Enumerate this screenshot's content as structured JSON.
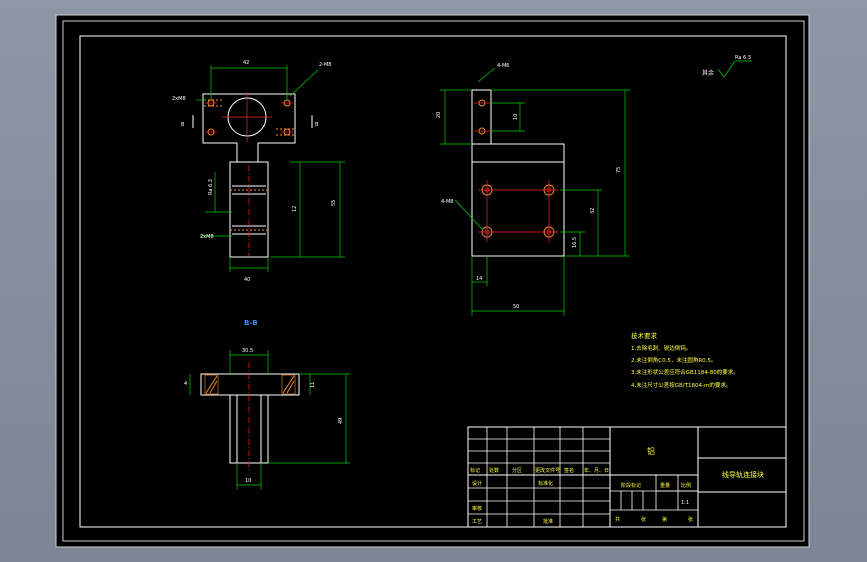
{
  "drawing": {
    "roughness_symbol_text": "Ra 6.3",
    "roughness_prefix": "其余",
    "section_label": "B-B",
    "label_4M6": "4-M6",
    "label_2M8": "2-M8",
    "label_4M8": "4-M8",
    "label_ra": "Ra 6.3",
    "label_thread": "2xM8"
  },
  "dimensions": {
    "top_width": "42",
    "left_height_1": "12",
    "left_height_2": "55",
    "bottom_width": "40",
    "right_small_h": "10",
    "right_hole_spacing": "32",
    "right_height": "75",
    "right_height_total": "95",
    "right_bottom_w1": "14",
    "right_bottom_w2": "50",
    "right_lower_h": "16.5",
    "bb_top_w": "30.5",
    "bb_t": "4",
    "bb_h1": "11",
    "bb_h2": "49",
    "bb_bottom_w": "10",
    "right_side_small": "12",
    "right_left_dim": "20"
  },
  "tech_requirements": {
    "title": "技术要求",
    "items": [
      "1.去除毛刺、锐边倒钝。",
      "2.未注倒角C0.5，未注圆角R0.5。",
      "3.未注形状公差应符合GB1184-80的要求。",
      "4.未注尺寸公差按GB/T1804-m的要求。"
    ]
  },
  "title_block": {
    "material": "铝",
    "part_name": "线导轨连接块",
    "row_headers": [
      "标记",
      "处数",
      "分区",
      "更改文件号",
      "签名",
      "年、月、日"
    ],
    "design": "设计",
    "standardize": "标准化",
    "stage_mark": "阶段标记",
    "weight": "重量",
    "scale_label": "比例",
    "scale": "1:1",
    "audit": "审核",
    "process": "工艺",
    "approve": "批准",
    "sheets_total": "共",
    "sheets_label": "张",
    "sheet_no": "第",
    "sheet_unit": "张"
  }
}
